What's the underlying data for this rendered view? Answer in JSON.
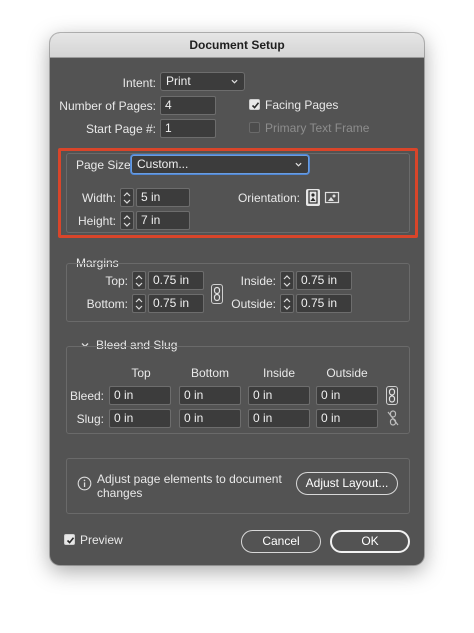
{
  "window": {
    "title": "Document Setup"
  },
  "document": {
    "intent_label": "Intent:",
    "intent_value": "Print",
    "pages_label": "Number of Pages:",
    "pages_value": "4",
    "start_page_label": "Start Page #:",
    "start_page_value": "1",
    "facing_pages_label": "Facing Pages",
    "facing_pages_checked": true,
    "primary_text_frame_label": "Primary Text Frame",
    "primary_text_frame_checked": false
  },
  "page_size": {
    "label": "Page Size:",
    "value": "Custom...",
    "width_label": "Width:",
    "width_value": "5 in",
    "height_label": "Height:",
    "height_value": "7 in",
    "orientation_label": "Orientation:",
    "orientation_icons": [
      "portrait-icon",
      "landscape-icon"
    ],
    "orientation_selected": "portrait"
  },
  "margins": {
    "title": "Margins",
    "top_label": "Top:",
    "top_value": "0.75 in",
    "bottom_label": "Bottom:",
    "bottom_value": "0.75 in",
    "inside_label": "Inside:",
    "inside_value": "0.75 in",
    "outside_label": "Outside:",
    "outside_value": "0.75 in",
    "link_icon": "chain-link-icon"
  },
  "bleed_slug": {
    "title": "Bleed and Slug",
    "columns": [
      "Top",
      "Bottom",
      "Inside",
      "Outside"
    ],
    "bleed_label": "Bleed:",
    "bleed_values": [
      "0 in",
      "0 in",
      "0 in",
      "0 in"
    ],
    "slug_label": "Slug:",
    "slug_values": [
      "0 in",
      "0 in",
      "0 in",
      "0 in"
    ]
  },
  "info": {
    "text_line1": "Adjust page elements to document",
    "text_line2": "changes",
    "adjust_button": "Adjust Layout..."
  },
  "footer": {
    "preview_label": "Preview",
    "preview_checked": true,
    "cancel_label": "Cancel",
    "ok_label": "OK"
  },
  "colors": {
    "dialog_bg": "#535353",
    "field_bg": "#3c3c3c",
    "highlight": "#d9452a",
    "focus_ring": "#4f86d4"
  }
}
